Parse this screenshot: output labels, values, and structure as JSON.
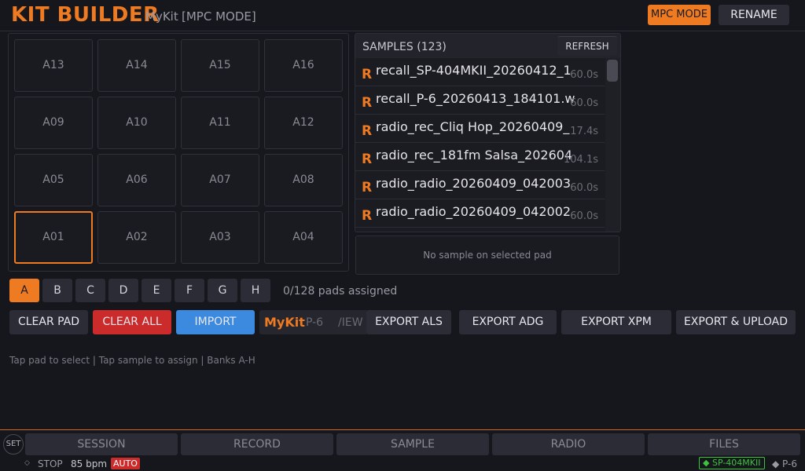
{
  "header": {
    "title": "KIT BUILDER",
    "kit_name": "MyKit",
    "mode": "[MPC MODE]",
    "mpc_mode_button": "MPC MODE",
    "rename_button": "RENAME"
  },
  "pads": [
    [
      "A13",
      "A14",
      "A15",
      "A16"
    ],
    [
      "A09",
      "A10",
      "A11",
      "A12"
    ],
    [
      "A05",
      "A06",
      "A07",
      "A08"
    ],
    [
      "A01",
      "A02",
      "A03",
      "A04"
    ]
  ],
  "selected_pad": "A01",
  "samples": {
    "header": "SAMPLES (123)",
    "refresh_label": "REFRESH",
    "items": [
      {
        "badge": "R",
        "name": "recall_SP-404MKII_20260412_1",
        "duration": "60.0s"
      },
      {
        "badge": "R",
        "name": "recall_P-6_20260413_184101.w",
        "duration": "60.0s"
      },
      {
        "badge": "R",
        "name": "radio_rec_Cliq Hop_20260409_",
        "duration": "17.4s"
      },
      {
        "badge": "R",
        "name": "radio_rec_181fm Salsa_202604",
        "duration": "104.1s"
      },
      {
        "badge": "R",
        "name": "radio_radio_20260409_042003",
        "duration": "60.0s"
      },
      {
        "badge": "R",
        "name": "radio_radio_20260409_042002",
        "duration": "60.0s"
      }
    ]
  },
  "selected_sample_info": "No sample on selected pad",
  "banks": [
    "A",
    "B",
    "C",
    "D",
    "E",
    "F",
    "G",
    "H"
  ],
  "active_bank": "A",
  "pads_assigned": "0/128 pads assigned",
  "actions": {
    "clear_pad": "CLEAR PAD",
    "clear_all": "CLEAR ALL",
    "import": "IMPORT",
    "kit_tab": "MyKit",
    "p6_tab": "P-6",
    "view_tab": "/IEW",
    "export_als": "EXPORT ALS",
    "export_adg": "EXPORT ADG",
    "export_xpm": "EXPORT XPM",
    "export_upload": "EXPORT & UPLOAD"
  },
  "hint": "Tap pad to select | Tap sample to assign | Banks A-H",
  "nav": {
    "set": "SET",
    "tabs": [
      "SESSION",
      "RECORD",
      "SAMPLE",
      "RADIO",
      "FILES"
    ]
  },
  "status": {
    "dot": "◇",
    "transport": "STOP",
    "bpm": "85 bpm",
    "auto": "AUTO",
    "device_active": "◆ SP-404MKII",
    "device_other": "◆ P-6"
  },
  "colors": {
    "accent": "#ee7a22",
    "danger": "#cc2b2b",
    "primary": "#3b8ae0",
    "device_ok": "#3cc43c"
  }
}
